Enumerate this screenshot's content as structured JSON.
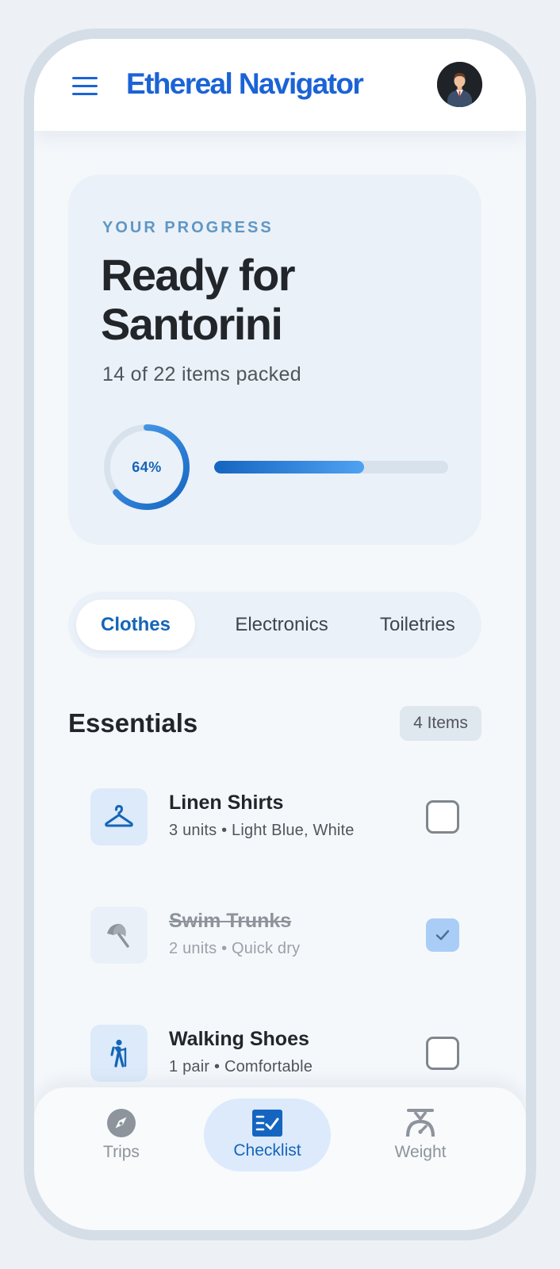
{
  "header": {
    "title": "Ethereal Navigator",
    "menu_icon": "menu-icon",
    "avatar_icon": "avatar"
  },
  "progress": {
    "eyebrow": "YOUR PROGRESS",
    "title": "Ready for Santorini",
    "subtitle": "14 of 22 items packed",
    "percent_label": "64%",
    "percent": 64
  },
  "tabs": [
    {
      "label": "Clothes",
      "active": true
    },
    {
      "label": "Electronics",
      "active": false
    },
    {
      "label": "Toiletries",
      "active": false
    }
  ],
  "section": {
    "title": "Essentials",
    "badge": "4 Items"
  },
  "items": [
    {
      "name": "Linen Shirts",
      "meta": "3 units • Light Blue, White",
      "checked": false,
      "icon": "hanger-icon"
    },
    {
      "name": "Swim Trunks",
      "meta": "2 units • Quick dry",
      "checked": true,
      "icon": "beach-umbrella-icon"
    },
    {
      "name": "Walking Shoes",
      "meta": "1 pair • Comfortable",
      "checked": false,
      "icon": "hiker-icon"
    }
  ],
  "nav": [
    {
      "label": "Trips",
      "icon": "compass-icon",
      "active": false
    },
    {
      "label": "Checklist",
      "icon": "checklist-icon",
      "active": true
    },
    {
      "label": "Weight",
      "icon": "scale-icon",
      "active": false
    }
  ],
  "colors": {
    "brand": "#1b63d6",
    "accent": "#1565b8",
    "progress_track": "#d8e2ec",
    "checked": "#a9cdf6"
  }
}
